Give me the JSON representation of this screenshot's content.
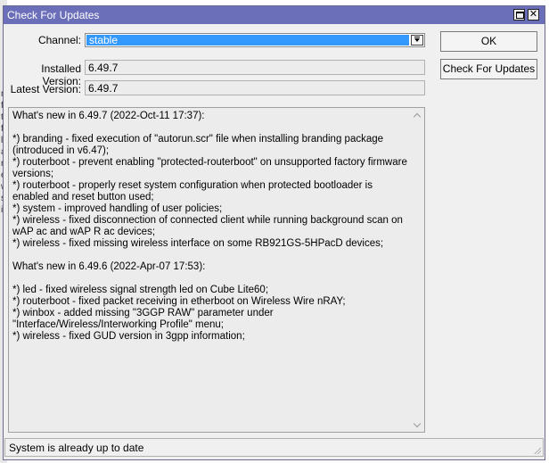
{
  "window": {
    "title": "Check For Updates",
    "close_label": "✕"
  },
  "background_glyphs": [
    "n",
    "f",
    "t",
    "f",
    "l",
    "a",
    "n",
    "e",
    "w",
    "s",
    "i"
  ],
  "form": {
    "channel_label": "Channel:",
    "channel_value": "stable",
    "installed_label": "Installed Version:",
    "installed_value": "6.49.7",
    "latest_label": "Latest Version:",
    "latest_value": "6.49.7"
  },
  "buttons": {
    "ok": "OK",
    "check": "Check For Updates"
  },
  "release_notes": "What's new in 6.49.7 (2022-Oct-11 17:37):\n\n*) branding - fixed execution of \"autorun.scr\" file when installing branding package (introduced in v6.47);\n*) routerboot - prevent enabling \"protected-routerboot\" on unsupported factory firmware versions;\n*) routerboot - properly reset system configuration when protected bootloader is enabled and reset button used;\n*) system - improved handling of user policies;\n*) wireless - fixed disconnection of connected client while running background scan on wAP ac and wAP R ac devices;\n*) wireless - fixed missing wireless interface on some RB921GS-5HPacD devices;\n\nWhat's new in 6.49.6 (2022-Apr-07 17:53):\n\n*) led - fixed wireless signal strength led on Cube Lite60;\n*) routerboot - fixed packet receiving in etherboot on Wireless Wire nRAY;\n*) winbox - added missing \"3GGP RAW\" parameter under \"Interface/Wireless/Interworking Profile\" menu;\n*) wireless - fixed GUD version in 3gpp information;",
  "status": {
    "text": "System is already up to date"
  },
  "colors": {
    "titlebar": "#6b6fba",
    "selection": "#3399ff",
    "window_bg": "#f0f0f0"
  },
  "icons": [
    "maximize-icon",
    "close-icon",
    "dropdown-arrow-icon",
    "scroll-up-icon",
    "scroll-down-icon",
    "resize-grip-icon"
  ]
}
